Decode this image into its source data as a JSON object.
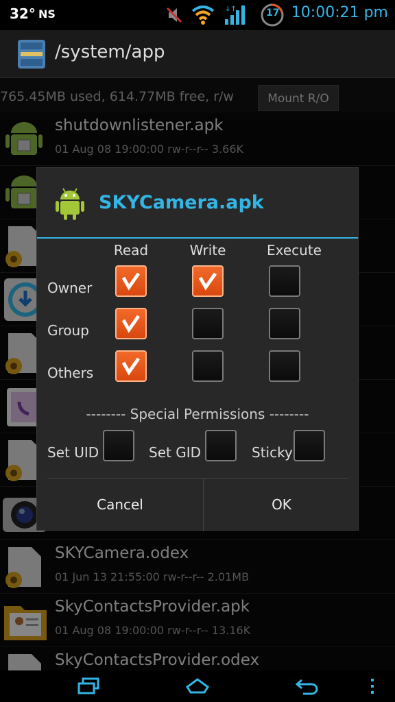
{
  "status_bar": {
    "temperature": "32°",
    "network_label": "NS",
    "notification_count": "17",
    "time": "10:00:21 pm"
  },
  "title_bar": {
    "path": "/system/app"
  },
  "storage": {
    "info": "765.45MB used, 614.77MB free, r/w",
    "mount_button": "Mount R/O"
  },
  "files": [
    {
      "name": "shutdownlistener.apk",
      "meta": "01 Aug 08 19:00:00  rw-r--r--  3.66K",
      "icon": "android-package-icon"
    },
    {
      "name": "",
      "meta": "",
      "icon": "android-package-icon"
    },
    {
      "name": "",
      "meta": "",
      "icon": "odex-file-icon"
    },
    {
      "name": "",
      "meta": "",
      "icon": "download-app-icon"
    },
    {
      "name": "",
      "meta": "",
      "icon": "odex-file-icon"
    },
    {
      "name": "",
      "meta": "",
      "icon": "phone-app-icon"
    },
    {
      "name": "",
      "meta": "",
      "icon": "odex-file-icon"
    },
    {
      "name": "",
      "meta": "",
      "icon": "camera-app-icon"
    },
    {
      "name": "SKYCamera.odex",
      "meta": "01 Jun 13 21:55:00  rw-r--r--  2.01MB",
      "icon": "odex-file-icon"
    },
    {
      "name": "SkyContactsProvider.apk",
      "meta": "01 Aug 08 19:00:00  rw-r--r--  13.16K",
      "icon": "contacts-app-icon"
    },
    {
      "name": "SkyContactsProvider.odex",
      "meta": "",
      "icon": "odex-file-icon"
    }
  ],
  "dialog": {
    "title": "SKYCamera.apk",
    "columns": [
      "Read",
      "Write",
      "Execute"
    ],
    "rows": [
      {
        "label": "Owner",
        "checks": [
          true,
          true,
          false
        ]
      },
      {
        "label": "Group",
        "checks": [
          true,
          false,
          false
        ]
      },
      {
        "label": "Others",
        "checks": [
          true,
          false,
          false
        ]
      }
    ],
    "special_heading": "-------- Special Permissions --------",
    "special": [
      {
        "label": "Set UID",
        "checked": false
      },
      {
        "label": "Set GID",
        "checked": false
      },
      {
        "label": "Sticky",
        "checked": false
      }
    ],
    "cancel_label": "Cancel",
    "ok_label": "OK"
  },
  "colors": {
    "accent": "#33b5e5",
    "checkbox_checked": "#e8561a"
  }
}
